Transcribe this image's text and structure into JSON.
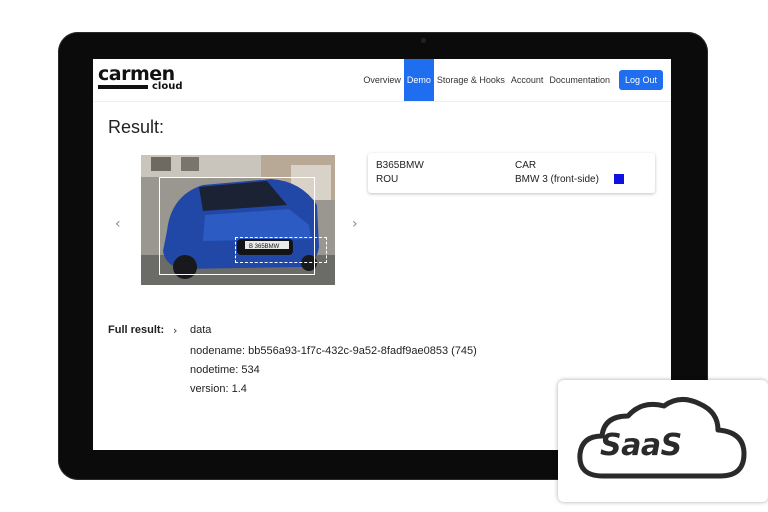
{
  "brand": {
    "name": "carmen",
    "sub": "cloud"
  },
  "nav": {
    "items": [
      {
        "label": "Overview",
        "active": false
      },
      {
        "label": "Demo",
        "active": true
      },
      {
        "label": "Storage & Hooks",
        "active": false
      },
      {
        "label": "Account",
        "active": false
      },
      {
        "label": "Documentation",
        "active": false
      }
    ],
    "logout_label": "Log Out"
  },
  "result": {
    "title": "Result:",
    "plate": "B365BMW",
    "country": "ROU",
    "category": "CAR",
    "make_model": "BMW 3 (front-side)",
    "color_swatch": "#1010e0",
    "photo_plate_text": "B 365BMW"
  },
  "carousel": {
    "prev_icon": "chevron-left-icon",
    "next_icon": "chevron-right-icon"
  },
  "full_result": {
    "label": "Full result:",
    "node": "data",
    "lines": [
      "nodename: bb556a93-1f7c-432c-9a52-8fadf9ae0853 (745)",
      "nodetime: 534",
      "version: 1.4"
    ]
  },
  "badge": {
    "text": "SaaS",
    "icon": "cloud-icon"
  },
  "colors": {
    "accent": "#1f6ef0",
    "frame": "#0b0b0b"
  }
}
